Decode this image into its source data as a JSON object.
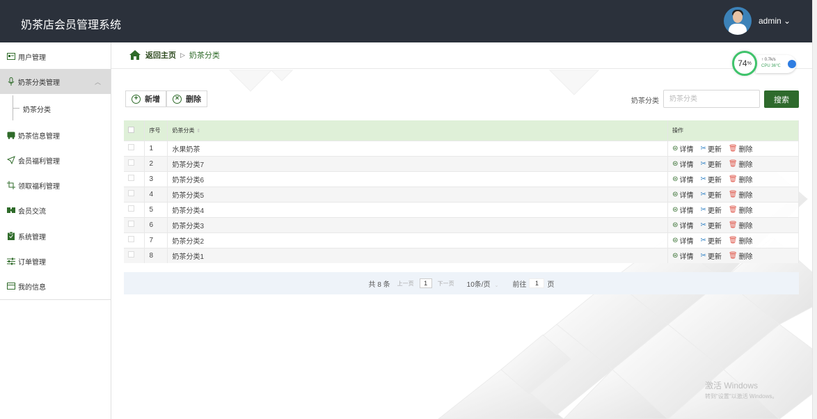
{
  "header": {
    "app_title": "奶茶店会员管理系统",
    "user_name": "admin ⌄"
  },
  "sidebar": {
    "items": [
      {
        "label": "用户管理",
        "icon": "user-card-icon"
      },
      {
        "label": "奶茶分类管理",
        "icon": "microphone-icon",
        "chevron": "︿"
      },
      {
        "label": "奶茶信息管理",
        "icon": "bus-icon"
      },
      {
        "label": "会员福利管理",
        "icon": "send-icon"
      },
      {
        "label": "领取福利管理",
        "icon": "crop-icon"
      },
      {
        "label": "会员交流",
        "icon": "exchange-icon"
      },
      {
        "label": "系统管理",
        "icon": "clipboard-icon"
      },
      {
        "label": "订单管理",
        "icon": "sliders-icon"
      },
      {
        "label": "我的信息",
        "icon": "card-icon"
      }
    ],
    "sub_item": "奶茶分类"
  },
  "breadcrumb": {
    "home": "返回主页",
    "separator": "▷",
    "current": "奶茶分类"
  },
  "cpu_widget": {
    "percent": "74",
    "unit": "%",
    "net": "↑ 0.7k/s",
    "cpu": "CPU 36℃"
  },
  "toolbar": {
    "add_label": "新增",
    "delete_label": "删除",
    "add_glyph": "+",
    "delete_glyph": "×"
  },
  "search": {
    "label": "奶茶分类",
    "placeholder": "奶茶分类",
    "button": "搜索"
  },
  "table": {
    "headers": {
      "index": "序号",
      "category": "奶茶分类",
      "sort": "⇕",
      "ops": "操作"
    },
    "rows": [
      {
        "index": "1",
        "category": "水果奶茶"
      },
      {
        "index": "2",
        "category": "奶茶分类7"
      },
      {
        "index": "3",
        "category": "奶茶分类6"
      },
      {
        "index": "4",
        "category": "奶茶分类5"
      },
      {
        "index": "5",
        "category": "奶茶分类4"
      },
      {
        "index": "6",
        "category": "奶茶分类3"
      },
      {
        "index": "7",
        "category": "奶茶分类2"
      },
      {
        "index": "8",
        "category": "奶茶分类1"
      }
    ],
    "actions": {
      "detail": "详情",
      "update": "更新",
      "delete": "删除"
    },
    "action_glyphs": {
      "detail": "⊜",
      "update": "✂",
      "delete": "🗑"
    }
  },
  "pager": {
    "total": "共 8 条",
    "prev": "上一页",
    "page": "1",
    "next": "下一页",
    "page_size": "10条/页",
    "page_size_chevron": "⌄",
    "goto_label": "前往",
    "goto_value": "1",
    "goto_suffix": "页"
  },
  "watermark": {
    "line1": "激活 Windows",
    "line2": "转到\"设置\"以激活 Windows。"
  }
}
